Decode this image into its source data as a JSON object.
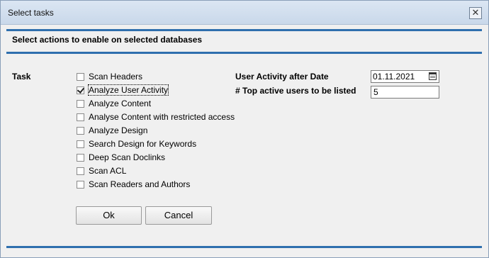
{
  "window": {
    "title": "Select tasks",
    "close_glyph": "✕"
  },
  "heading": "Select actions to enable on selected databases",
  "task_label": "Task",
  "tasks": [
    {
      "label": "Scan Headers",
      "checked": false
    },
    {
      "label": "Analyze User Activity",
      "checked": true
    },
    {
      "label": "Analyze Content",
      "checked": false
    },
    {
      "label": "Analyse Content with restricted access",
      "checked": false
    },
    {
      "label": "Analyze Design",
      "checked": false
    },
    {
      "label": "Search Design for Keywords",
      "checked": false
    },
    {
      "label": "Deep Scan Doclinks",
      "checked": false
    },
    {
      "label": "Scan ACL",
      "checked": false
    },
    {
      "label": "Scan Readers and Authors",
      "checked": false
    }
  ],
  "fields": {
    "activity_date_label": "User Activity after Date",
    "activity_date_value": "01.11.2021",
    "top_users_label": "# Top active users to be listed",
    "top_users_value": "5"
  },
  "buttons": {
    "ok": "Ok",
    "cancel": "Cancel"
  },
  "colors": {
    "rule": "#2f6fae",
    "titlebar": "#c9d8ea"
  }
}
